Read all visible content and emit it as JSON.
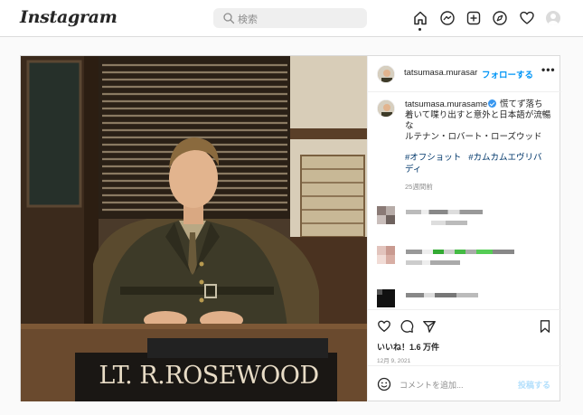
{
  "nav": {
    "logo": "Instagram",
    "search_placeholder": "検索"
  },
  "post": {
    "username": "tatsumasa.murasame",
    "header_username": "tatsumasa.murasar",
    "follow_label": "フォローする",
    "more_label": "•••",
    "caption_line1": "慌てず落ち",
    "caption_line2": "着いて喋り出すと意外と日本語が流暢",
    "caption_line3": "な",
    "caption_line4": "ルテナン・ロバート・ローズウッド",
    "hashtag1": "#オフショット",
    "hashtag2": "#カムカムエヴリバ",
    "hashtag2_cont": "ディ",
    "time_ago": "25週間前",
    "likes": "いいね！1.6 万件",
    "date": "12月 9, 2021",
    "comment_placeholder": "コメントを追加...",
    "post_button": "投稿する",
    "nameplate": "LT. R.ROSEWOOD"
  },
  "colors": {
    "accent": "#0095f6",
    "hashtag": "#00376b",
    "muted": "#8e8e8e",
    "verified": "#3897f0"
  }
}
